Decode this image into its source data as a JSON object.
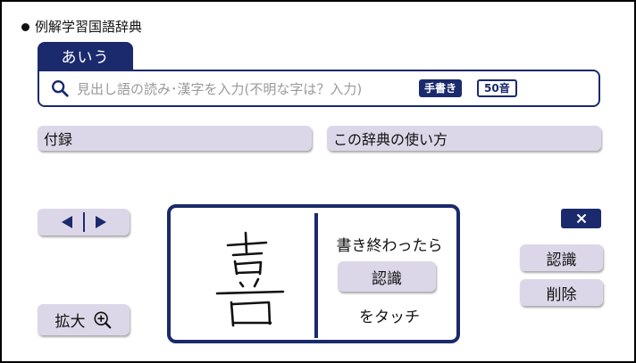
{
  "header": {
    "dictionary_title": "例解学習国語辞典"
  },
  "search": {
    "mode_tab": "あいう",
    "placeholder": "見出し語の読み･漢字を入力(不明な字は？入力)",
    "handwriting_label": "手書き",
    "gojuon_label": "50音"
  },
  "menu": {
    "appendix": "付録",
    "how_to_use": "この辞典の使い方"
  },
  "controls": {
    "zoom_label": "拡大"
  },
  "handwriting": {
    "instruction_top": "書き終わったら",
    "recognize_label": "認識",
    "instruction_bottom": "をタッチ"
  },
  "side_buttons": {
    "recognize": "認識",
    "delete": "削除"
  },
  "icons": [
    "search-icon",
    "nav-left-icon",
    "nav-right-icon",
    "zoom-in-icon",
    "close-icon"
  ],
  "colors": {
    "accent": "#1a2a6c",
    "button_bg": "#dcd7e8"
  }
}
